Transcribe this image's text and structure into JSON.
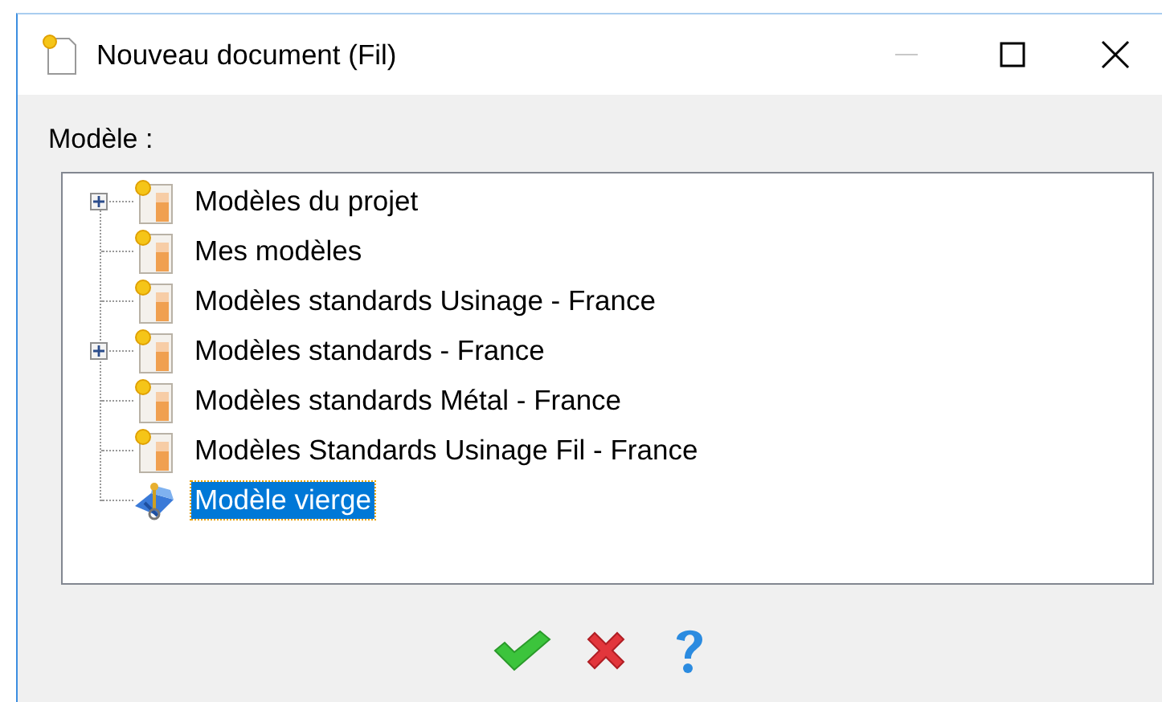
{
  "window": {
    "title": "Nouveau document (Fil)"
  },
  "template_label": "Modèle :",
  "tree": {
    "items": [
      {
        "label": "Modèles du projet",
        "kind": "folder",
        "expanded": false,
        "selected": false
      },
      {
        "label": "Mes modèles",
        "kind": "folder",
        "selected": false
      },
      {
        "label": "Modèles standards Usinage - France",
        "kind": "folder",
        "selected": false
      },
      {
        "label": "Modèles standards - France",
        "kind": "folder",
        "expanded": false,
        "selected": false
      },
      {
        "label": "Modèles standards Métal - France",
        "kind": "folder",
        "selected": false
      },
      {
        "label": "Modèles Standards Usinage Fil - France",
        "kind": "folder",
        "selected": false
      },
      {
        "label": "Modèle vierge",
        "kind": "blank",
        "selected": true
      }
    ]
  }
}
